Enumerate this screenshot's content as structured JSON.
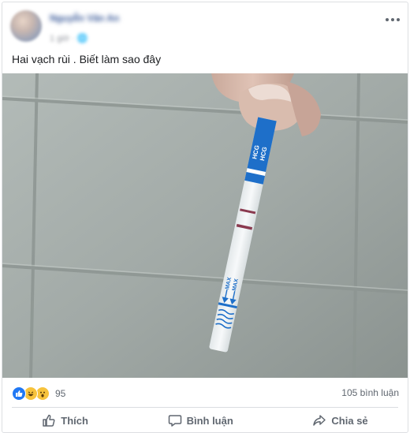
{
  "post": {
    "author": "Nguyễn Văn An",
    "time": "1 giờ · 🌐",
    "status_text": "Hai vạch rùi . Biết làm sao đây"
  },
  "photo": {
    "strip_label_top": "HCG",
    "strip_label_bottom": "HCG",
    "max_label_left": "MAX",
    "max_label_right": "MAX"
  },
  "stats": {
    "reaction_icons": [
      "like-icon",
      "haha-icon",
      "wow-icon"
    ],
    "reaction_count": "95",
    "comment_count": "105 bình luận"
  },
  "actions": {
    "like_label": "Thích",
    "comment_label": "Bình luận",
    "share_label": "Chia sẻ"
  },
  "colors": {
    "link_blue": "#385898",
    "like_blue": "#2078f4",
    "text_gray": "#606770",
    "strip_blue": "#1e6fc9",
    "control_line": "#8a3a4f"
  }
}
